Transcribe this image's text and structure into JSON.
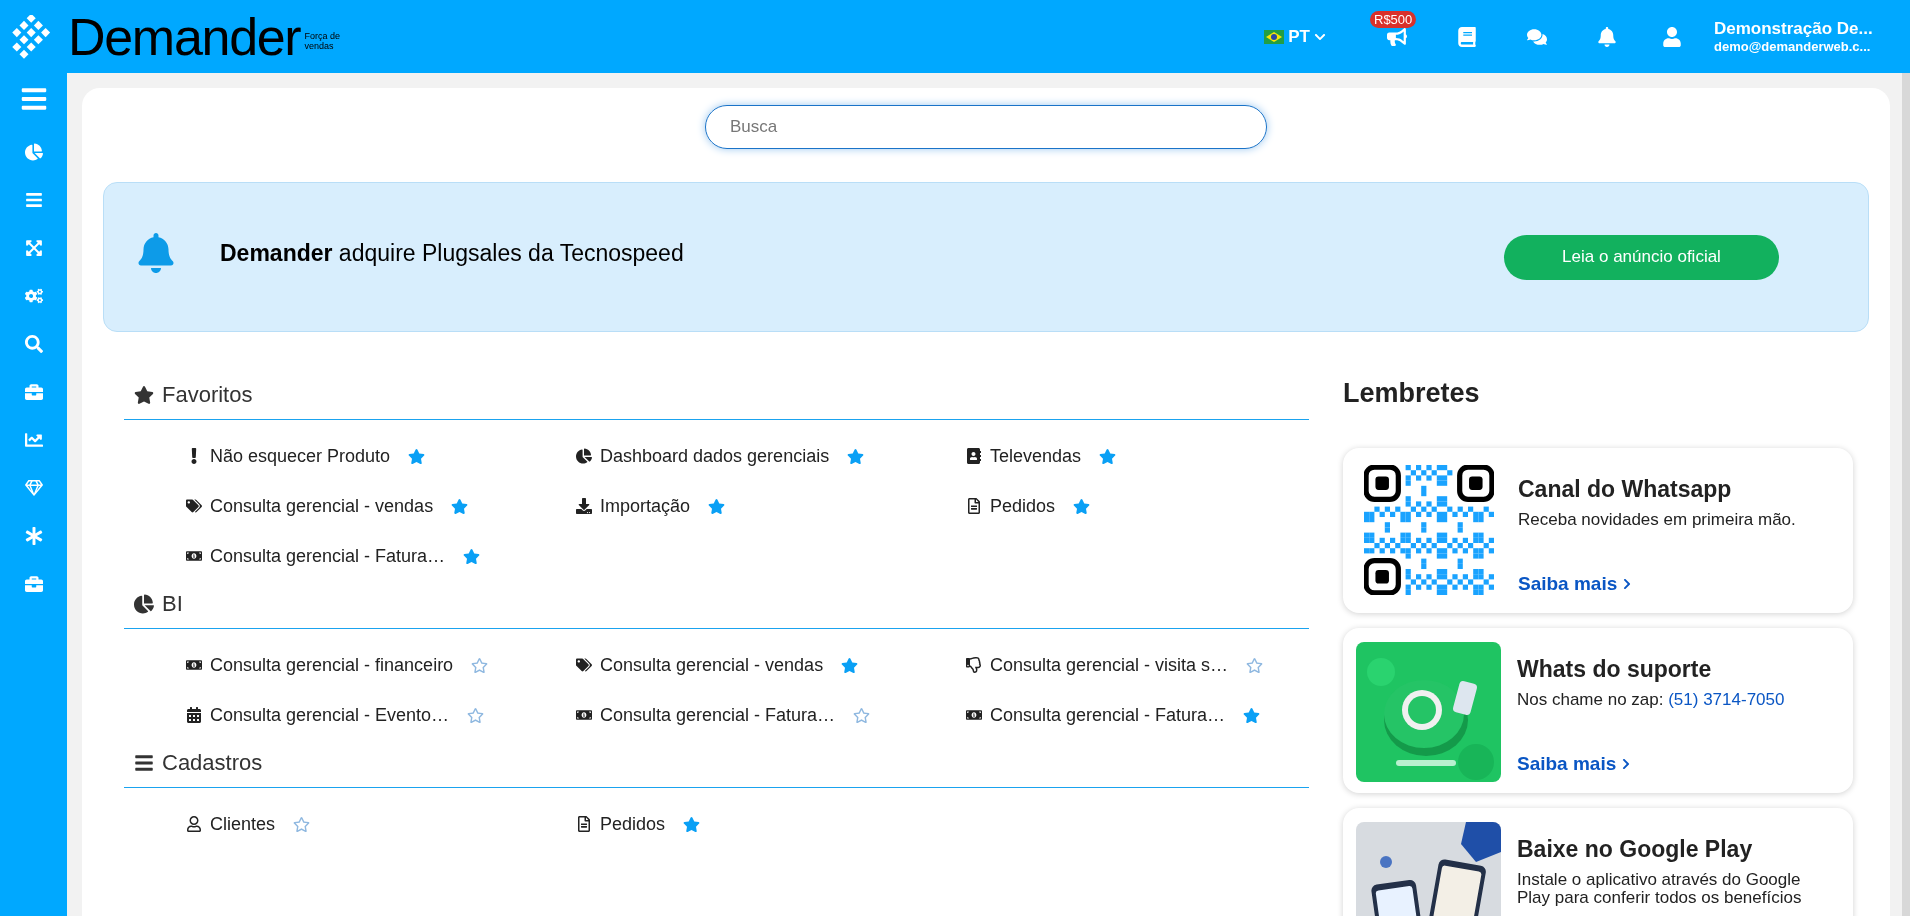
{
  "header": {
    "logo_text": "Demander",
    "logo_tagline": "Força de vendas",
    "language": "PT",
    "badge": "R$500",
    "user_name": "Demonstração De...",
    "user_email": "demo@demanderweb.c..."
  },
  "search": {
    "placeholder": "Busca"
  },
  "banner": {
    "text": "**Demander** adquire Plugsales da Tecnospeed",
    "button": "Leia o anúncio oficial"
  },
  "sections": [
    {
      "title": "Favoritos",
      "kind": "star",
      "items": [
        {
          "label": "Não esquecer Produto",
          "kind": "exclamation",
          "starred": true
        },
        {
          "label": "Dashboard dados gerenciais",
          "kind": "pie",
          "starred": true
        },
        {
          "label": "Televendas",
          "kind": "contact",
          "starred": true
        },
        {
          "label": "Consulta gerencial - vendas",
          "kind": "tags",
          "starred": true
        },
        {
          "label": "Importação",
          "kind": "download",
          "starred": true
        },
        {
          "label": "Pedidos",
          "kind": "file",
          "starred": true
        },
        {
          "label": "Consulta gerencial - Fatura…",
          "kind": "money",
          "starred": true
        }
      ]
    },
    {
      "title": "BI",
      "kind": "pie",
      "items": [
        {
          "label": "Consulta gerencial - financeiro",
          "kind": "money",
          "starred": false
        },
        {
          "label": "Consulta gerencial - vendas",
          "kind": "tags",
          "starred": true
        },
        {
          "label": "Consulta gerencial - visita s…",
          "kind": "thumbsdown",
          "starred": false
        },
        {
          "label": "Consulta gerencial - Evento…",
          "kind": "calendar",
          "starred": false
        },
        {
          "label": "Consulta gerencial - Fatura…",
          "kind": "money",
          "starred": false
        },
        {
          "label": "Consulta gerencial - Fatura…",
          "kind": "money",
          "starred": true
        }
      ]
    },
    {
      "title": "Cadastros",
      "kind": "bars",
      "items": [
        {
          "label": "Clientes",
          "kind": "user",
          "starred": false
        },
        {
          "label": "Pedidos",
          "kind": "file",
          "starred": true
        }
      ]
    }
  ],
  "reminders": {
    "title": "Lembretes",
    "cards": [
      {
        "kind": "qr",
        "title": "Canal do Whatsapp",
        "text": "Receba novidades em primeira mão.",
        "link": "Saiba mais"
      },
      {
        "kind": "picture",
        "title": "Whats do suporte",
        "text": "Nos chame no zap:",
        "phone": "(51) 3714-7050",
        "link": "Saiba mais"
      },
      {
        "kind": "picture",
        "title": "Baixe no Google Play",
        "text": "Instale o aplicativo através do Google Play para conferir todos os benefícios"
      }
    ]
  }
}
